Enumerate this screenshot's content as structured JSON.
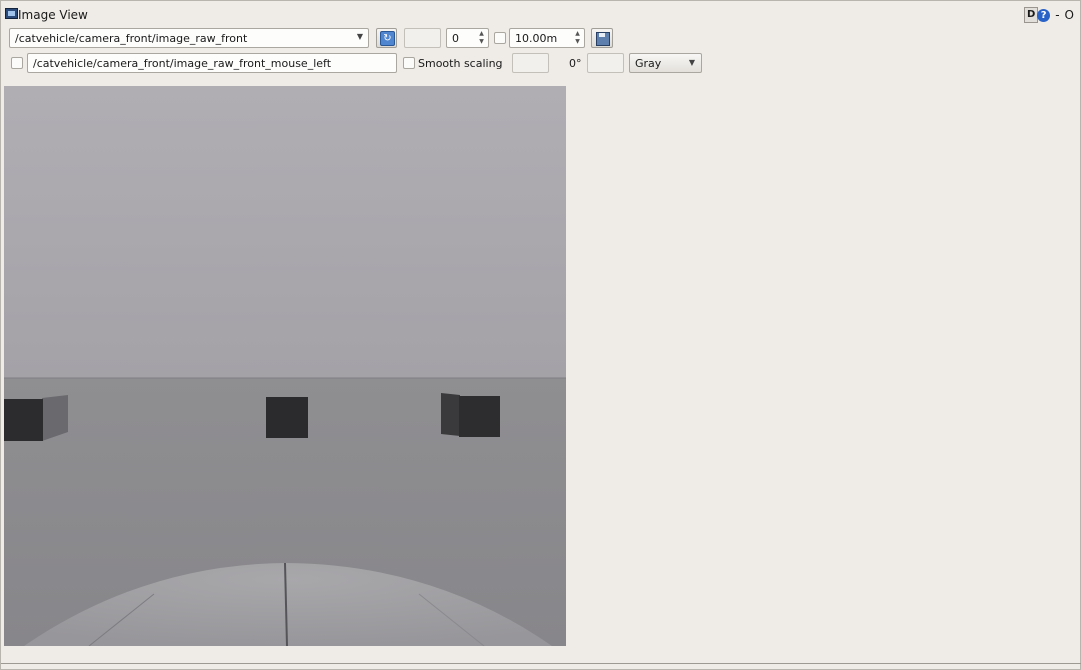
{
  "window": {
    "title": "Image View",
    "controls": {
      "detach": "D",
      "help": "?",
      "minimize": "-",
      "close": "O"
    }
  },
  "toolbar": {
    "topic": "/catvehicle/camera_front/image_raw_front",
    "number_value": "0",
    "max_range": "10.00m"
  },
  "options": {
    "mouse_topic": "/catvehicle/camera_front/image_raw_front_mouse_left",
    "smooth_scaling_label": "Smooth scaling",
    "rotation": "0°",
    "colormap": "Gray"
  },
  "icons": {
    "window": "image-view-window-icon",
    "refresh": "refresh-icon",
    "save": "save-icon",
    "dropdown": "chevron-down-icon"
  }
}
